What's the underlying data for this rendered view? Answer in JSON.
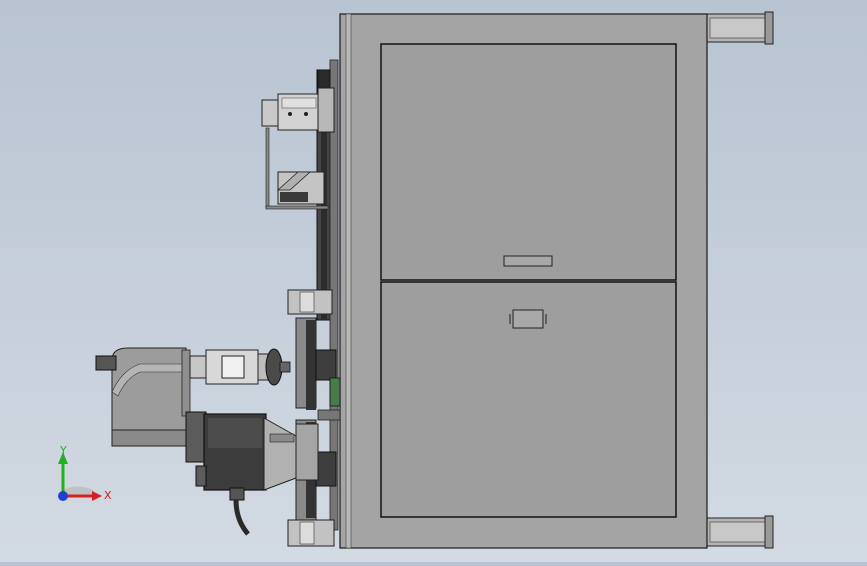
{
  "viewport": {
    "background_top": "#b9c4d2",
    "background_bottom": "#d3dae3"
  },
  "model": {
    "cabinet_color": "#a3a3a3",
    "door_color": "#9d9d9d",
    "edge_color": "#1a1a1a",
    "dark_part_color": "#3a3a3a"
  },
  "triad": {
    "x_label": "X",
    "y_label": "Y",
    "x_color": "#d42020",
    "y_color": "#20b020",
    "z_color": "#2040d0"
  }
}
